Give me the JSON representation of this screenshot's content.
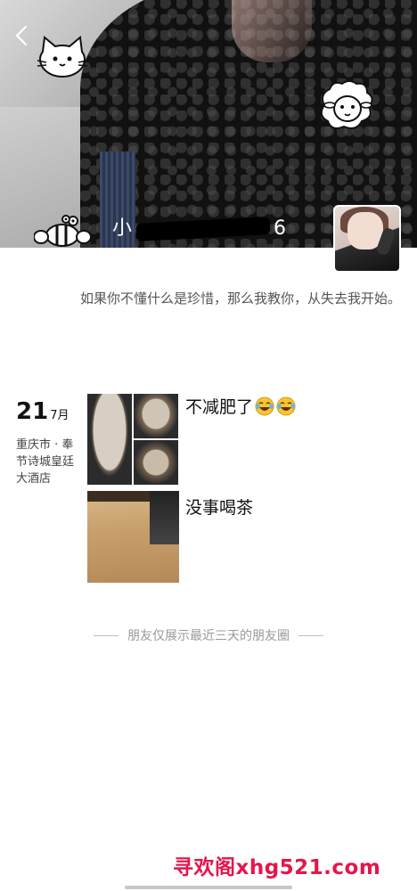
{
  "header": {
    "username_visible_prefix": "小",
    "username_visible_suffix": "6",
    "signature": "如果你不懂什么是珍惜，那么我教你，从失去我开始。"
  },
  "icons": {
    "back": "chevron-left-icon",
    "cat": "cat-sticker-icon",
    "sheep": "sheep-sticker-icon",
    "bee": "bee-sticker-icon",
    "emoji": "crying-laughing-emoji-icon"
  },
  "feed": {
    "date_day": "21",
    "date_month": "7月",
    "location": "重庆市 · 奉节诗城皇廷大酒店",
    "posts": [
      {
        "text": "不减肥了",
        "emoji_count": 2,
        "photo_count": 3
      },
      {
        "text": "没事喝茶",
        "emoji_count": 0,
        "photo_count": 1
      }
    ]
  },
  "footer": {
    "note": "朋友仅展示最近三天的朋友圈"
  },
  "watermark": {
    "text": "寻欢阁xhg521.com",
    "color": "#e5154a"
  }
}
